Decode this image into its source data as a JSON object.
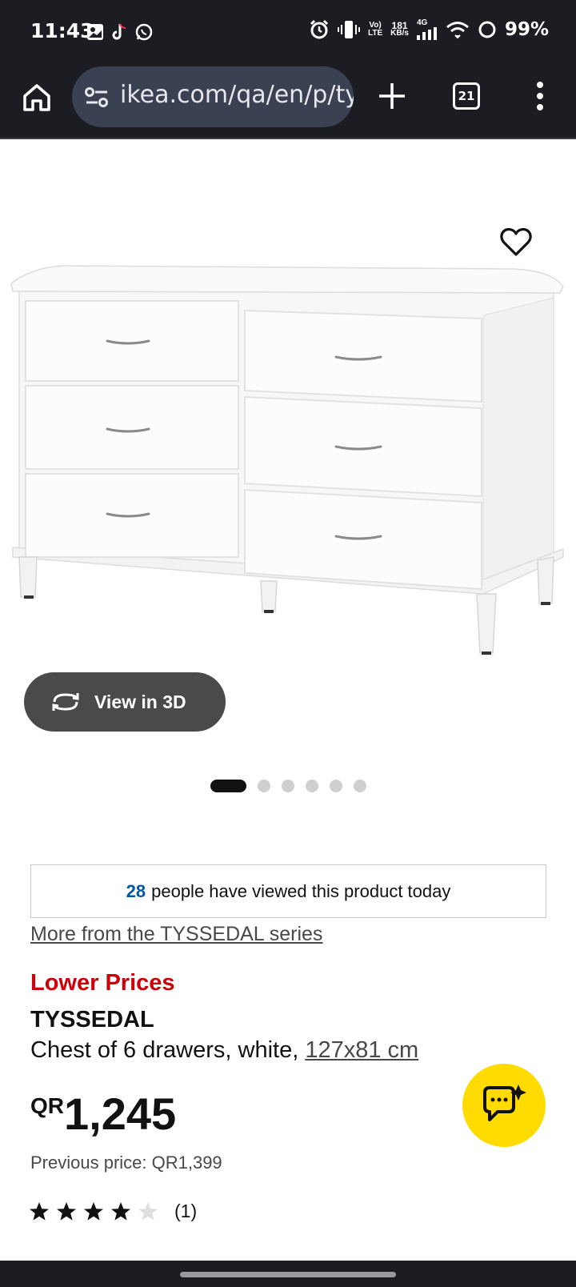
{
  "status_bar": {
    "time": "11:43",
    "volte_top": "Vo)",
    "volte_bottom": "LTE",
    "net_speed_value": "181",
    "net_speed_unit": "KB/s",
    "network_type": "4G",
    "battery": "99%",
    "icons": [
      "gallery-icon",
      "tiktok-icon",
      "whatsapp-icon",
      "alarm-icon",
      "vibrate-icon",
      "signal-icon",
      "wifi-icon",
      "battery-icon"
    ]
  },
  "browser": {
    "url": "ikea.com/qa/en/p/tyssedal",
    "tab_count": "21"
  },
  "product": {
    "view_3d_label": "View in 3D",
    "carousel_total": 6,
    "carousel_active": 1,
    "viewed_count": "28",
    "viewed_text": "people have viewed this product today",
    "series_link": "More from the TYSSEDAL series",
    "badge": "Lower Prices",
    "name": "TYSSEDAL",
    "description": "Chest of 6 drawers, white,",
    "size": "127x81 cm",
    "currency": "QR",
    "price": "1,245",
    "previous_price": "Previous price: QR1,399",
    "rating_value": 4,
    "rating_max": 5,
    "rating_count": "(1)"
  },
  "colors": {
    "status_bg": "#1b1d22",
    "url_pill": "#3a4152",
    "badge_red": "#cc0008",
    "link_blue": "#0058a3",
    "chat_yellow": "#ffdb00"
  }
}
